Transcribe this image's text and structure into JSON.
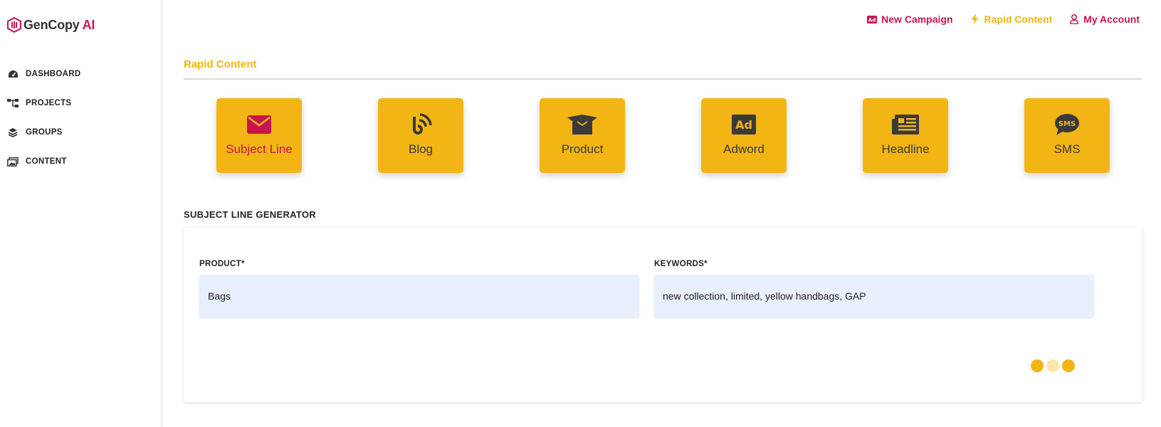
{
  "brand": {
    "name": "GenCopy",
    "suffix": "AI",
    "accent": "#c8154d"
  },
  "sidebar": {
    "items": [
      {
        "label": "DASHBOARD",
        "icon": "gauge-icon"
      },
      {
        "label": "PROJECTS",
        "icon": "sitemap-icon"
      },
      {
        "label": "GROUPS",
        "icon": "layers-icon"
      },
      {
        "label": "CONTENT",
        "icon": "images-icon"
      }
    ]
  },
  "topnav": {
    "new_campaign": {
      "label": "New Campaign",
      "icon": "ad-icon",
      "color": "#c8154d"
    },
    "rapid_content": {
      "label": "Rapid Content",
      "icon": "bolt-icon",
      "color": "#f0b514"
    },
    "my_account": {
      "label": "My Account",
      "icon": "user-icon",
      "color": "#c8154d"
    }
  },
  "main": {
    "section_title": "Rapid Content",
    "tiles": [
      {
        "label": "Subject Line",
        "icon": "envelope-icon",
        "active": true
      },
      {
        "label": "Blog",
        "icon": "rss-icon",
        "active": false
      },
      {
        "label": "Product",
        "icon": "box-icon",
        "active": false
      },
      {
        "label": "Adword",
        "icon": "ad-icon",
        "active": false
      },
      {
        "label": "Headline",
        "icon": "newspaper-icon",
        "active": false
      },
      {
        "label": "SMS",
        "icon": "sms-icon",
        "active": false
      }
    ],
    "generator_title": "SUBJECT LINE GENERATOR",
    "fields": {
      "product": {
        "label": "PRODUCT*",
        "value": "Bags"
      },
      "keywords": {
        "label": "KEYWORDS*",
        "value": "new collection, limited, yellow handbags, GAP"
      }
    },
    "loader_colors": [
      "#f2b514",
      "#fbe6b0",
      "#f2b514"
    ]
  }
}
